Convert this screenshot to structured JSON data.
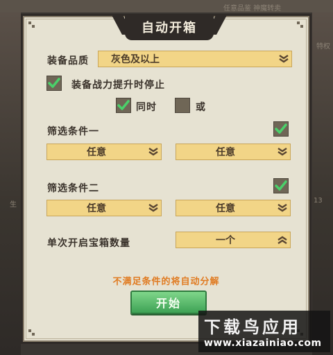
{
  "background": {
    "top_text": "任意品鉴  神魔转卖",
    "side_left": "生",
    "side_right": "13",
    "side_right_top": "特权"
  },
  "dialog": {
    "title": "自动开箱",
    "quality": {
      "label": "装备品质",
      "value": "灰色及以上"
    },
    "stop_on_power": {
      "label": "装备战力提升时停止",
      "checked": true
    },
    "logic": {
      "and_label": "同时",
      "and_checked": true,
      "or_label": "或",
      "or_checked": false
    },
    "filter1": {
      "label": "筛选条件一",
      "checked": true,
      "option_a": "任意",
      "option_b": "任意"
    },
    "filter2": {
      "label": "筛选条件二",
      "checked": true,
      "option_a": "任意",
      "option_b": "任意"
    },
    "count": {
      "label": "单次开启宝箱数量",
      "value": "一个"
    },
    "note": "不满足条件的将自动分解",
    "start_button": "开始"
  },
  "watermark": {
    "title": "下载鸟应用",
    "url": "www.xiazainiao.com"
  },
  "colors": {
    "dropdown": "#f2d587",
    "check": "#4ad16a",
    "note": "#e07a20",
    "button": "#4fb463"
  }
}
